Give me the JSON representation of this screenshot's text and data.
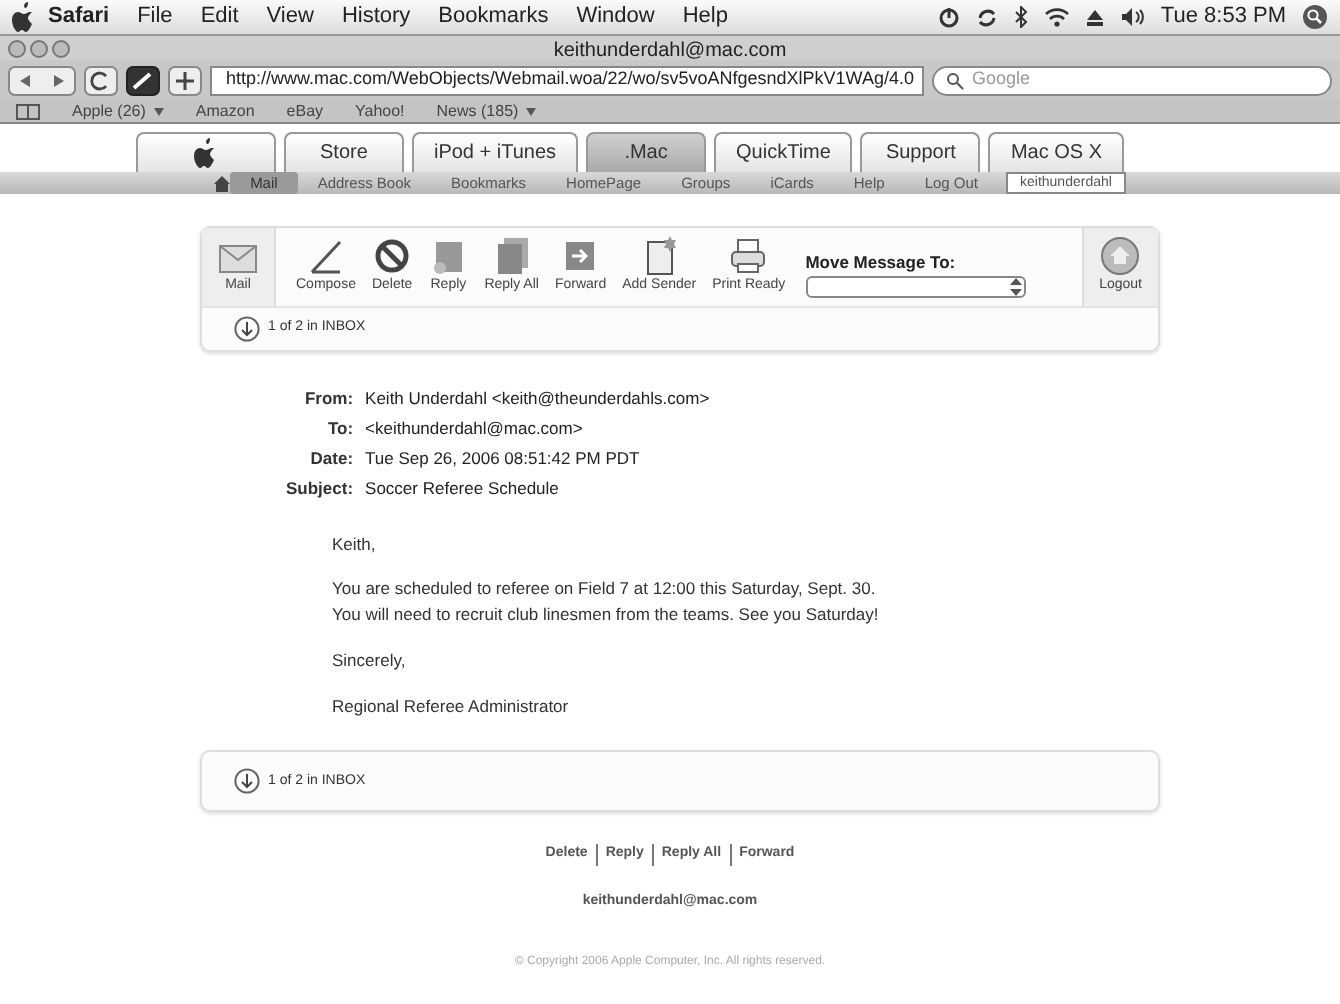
{
  "menubar": {
    "items": [
      "Safari",
      "File",
      "Edit",
      "View",
      "History",
      "Bookmarks",
      "Window",
      "Help"
    ],
    "clock": "Tue 8:53 PM"
  },
  "window": {
    "title": "keithunderdahl@mac.com"
  },
  "browser": {
    "url": "http://www.mac.com/WebObjects/Webmail.woa/22/wo/sv5voANfgesndXlPkV1WAg/4.0",
    "search_placeholder": "Google",
    "bookmarks": [
      {
        "label": "Apple (26)",
        "menu": true
      },
      {
        "label": "Amazon",
        "menu": false
      },
      {
        "label": "eBay",
        "menu": false
      },
      {
        "label": "Yahoo!",
        "menu": false
      },
      {
        "label": "News (185)",
        "menu": true
      }
    ]
  },
  "site_tabs": [
    {
      "kind": "logo",
      "selected": false
    },
    {
      "kind": "text",
      "label": "Store",
      "selected": false
    },
    {
      "kind": "text",
      "label": "iPod + iTunes",
      "selected": false
    },
    {
      "kind": "text",
      "label": ".Mac",
      "selected": true
    },
    {
      "kind": "text",
      "label": "QuickTime",
      "selected": false
    },
    {
      "kind": "text",
      "label": "Support",
      "selected": false
    },
    {
      "kind": "text",
      "label": "Mac OS X",
      "selected": false
    }
  ],
  "subnav": {
    "items": [
      {
        "label": "Mail",
        "selected": true
      },
      {
        "label": "Address Book",
        "selected": false
      },
      {
        "label": "Bookmarks",
        "selected": false
      },
      {
        "label": "HomePage",
        "selected": false
      },
      {
        "label": "Groups",
        "selected": false
      },
      {
        "label": "iCards",
        "selected": false
      },
      {
        "label": "Help",
        "selected": false
      },
      {
        "label": "Log Out",
        "selected": false
      }
    ],
    "user": "keithunderdahl"
  },
  "mail_toolbar": {
    "mail_label": "Mail",
    "actions": [
      {
        "kind": "compose",
        "label": "Compose"
      },
      {
        "kind": "delete",
        "label": "Delete"
      },
      {
        "kind": "reply",
        "label": "Reply"
      },
      {
        "kind": "replyall",
        "label": "Reply All"
      },
      {
        "kind": "forward",
        "label": "Forward"
      },
      {
        "kind": "addsender",
        "label": "Add Sender"
      },
      {
        "kind": "print",
        "label": "Print Ready"
      }
    ],
    "move_label": "Move Message To:",
    "logout_label": "Logout",
    "position": "1 of 2 in INBOX"
  },
  "headers": [
    {
      "label": "From:",
      "value": "Keith Underdahl <keith@theunderdahls.com>"
    },
    {
      "label": "To:",
      "value": "<keithunderdahl@mac.com>"
    },
    {
      "label": "Date:",
      "value": "Tue Sep 26, 2006 08:51:42 PM PDT"
    },
    {
      "label": "Subject:",
      "value": "Soccer Referee Schedule"
    }
  ],
  "body": [
    [
      "Keith,"
    ],
    [
      "You are scheduled to referee on Field 7 at 12:00 this Saturday, Sept. 30.",
      "You will need to recruit club linesmen from the teams. See you Saturday!"
    ],
    [
      "Sincerely,"
    ],
    [
      "Regional Referee Administrator"
    ]
  ],
  "bottom_position": "1 of 2 in INBOX",
  "footer_links": [
    "Delete",
    "Reply",
    "Reply All",
    "Forward"
  ],
  "footer_email": "keithunderdahl@mac.com",
  "copyright": "© Copyright 2006 Apple Computer, Inc. All rights reserved."
}
